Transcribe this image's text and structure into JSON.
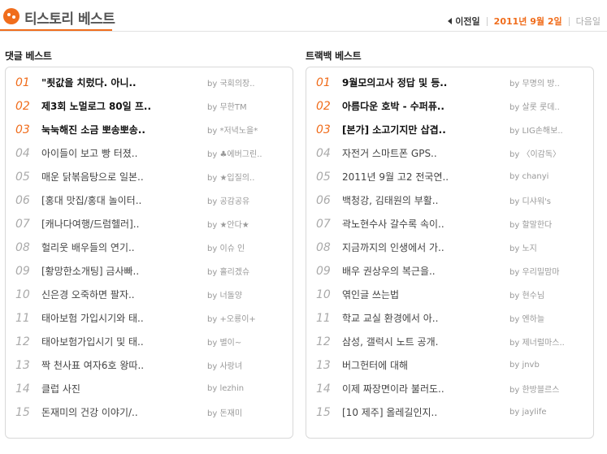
{
  "header": {
    "brand": "티스토리 베스트",
    "prev_label": "이전일",
    "current_date": "2011년 9월 2일",
    "next_label": "다음일"
  },
  "comments": {
    "title": "댓글 베스트",
    "items": [
      {
        "rank": "01",
        "title": "\"죗값을 치렀다. 아니..",
        "by": "by 국회의장.."
      },
      {
        "rank": "02",
        "title": "제3회 노멀로그 80일 프..",
        "by": "by 무한TM"
      },
      {
        "rank": "03",
        "title": "눅눅해진 소금 뽀송뽀송..",
        "by": "by *저녁노을*"
      },
      {
        "rank": "04",
        "title": "아이들이 보고 빵 터졌..",
        "by": "by ♣에버그린.."
      },
      {
        "rank": "05",
        "title": "매운 닭볶음탕으로 일본..",
        "by": "by ★입질의.."
      },
      {
        "rank": "06",
        "title": "[홍대 맛집/홍대 놀이터..",
        "by": "by 공감공유"
      },
      {
        "rank": "07",
        "title": "[캐나다여행/드럼헬러]..",
        "by": "by ★안다★"
      },
      {
        "rank": "08",
        "title": "헐리웃 배우들의 연기..",
        "by": "by 이슈 인"
      },
      {
        "rank": "09",
        "title": "[황망한소개팅] 금사빠..",
        "by": "by 홀리겠슈"
      },
      {
        "rank": "10",
        "title": "신은경 오죽하면 팔자..",
        "by": "by 너돌양"
      },
      {
        "rank": "11",
        "title": "태아보험 가입시기와 태..",
        "by": "by +오룡이+"
      },
      {
        "rank": "12",
        "title": "태아보험가입시기 및 태..",
        "by": "by 별이~"
      },
      {
        "rank": "13",
        "title": "짝 천사표 여자6호 왕따..",
        "by": "by 사랑녀"
      },
      {
        "rank": "14",
        "title": "클럽 사진",
        "by": "by lezhin"
      },
      {
        "rank": "15",
        "title": "돈재미의 건강 이야기/..",
        "by": "by 돈재미"
      }
    ]
  },
  "trackbacks": {
    "title": "트랙백 베스트",
    "items": [
      {
        "rank": "01",
        "title": "9월모의고사 정답 및 등..",
        "by": "by 무명의 방.."
      },
      {
        "rank": "02",
        "title": "아름다운 호박 - 수퍼퓨..",
        "by": "by 살롯 룻데.."
      },
      {
        "rank": "03",
        "title": "[본가] 소고기지만 삽겹..",
        "by": "by LIG손해보.."
      },
      {
        "rank": "04",
        "title": "자전거 스마트폰 GPS..",
        "by": "by 〈이감독〉"
      },
      {
        "rank": "05",
        "title": "2011년 9월 고2 전국연..",
        "by": "by chanyi"
      },
      {
        "rank": "06",
        "title": "백청강, 김태원의 부활..",
        "by": "by 디샤워's"
      },
      {
        "rank": "07",
        "title": "곽노현수사 갈수록 속이..",
        "by": "by 할말한다"
      },
      {
        "rank": "08",
        "title": "지금까지의 인생에서 가..",
        "by": "by 노지"
      },
      {
        "rank": "09",
        "title": "배우 권상우의 복근을..",
        "by": "by 우리밀맘마"
      },
      {
        "rank": "10",
        "title": "엮인글 쓰는법",
        "by": "by 현수님"
      },
      {
        "rank": "11",
        "title": "학교 교실 환경에서 아..",
        "by": "by 엔하늘"
      },
      {
        "rank": "12",
        "title": "삼성, 갤럭시 노트 공개.",
        "by": "by 제너럴마스.."
      },
      {
        "rank": "13",
        "title": "버그헌터에 대해",
        "by": "by jnvb"
      },
      {
        "rank": "14",
        "title": "이제 짜장면이라 불러도..",
        "by": "by 한방블르스"
      },
      {
        "rank": "15",
        "title": "[10 제주] 올레길인지..",
        "by": "by jaylife"
      }
    ]
  },
  "colors": {
    "accent": "#f06d1c",
    "rank_muted": "#aaaaaa"
  }
}
